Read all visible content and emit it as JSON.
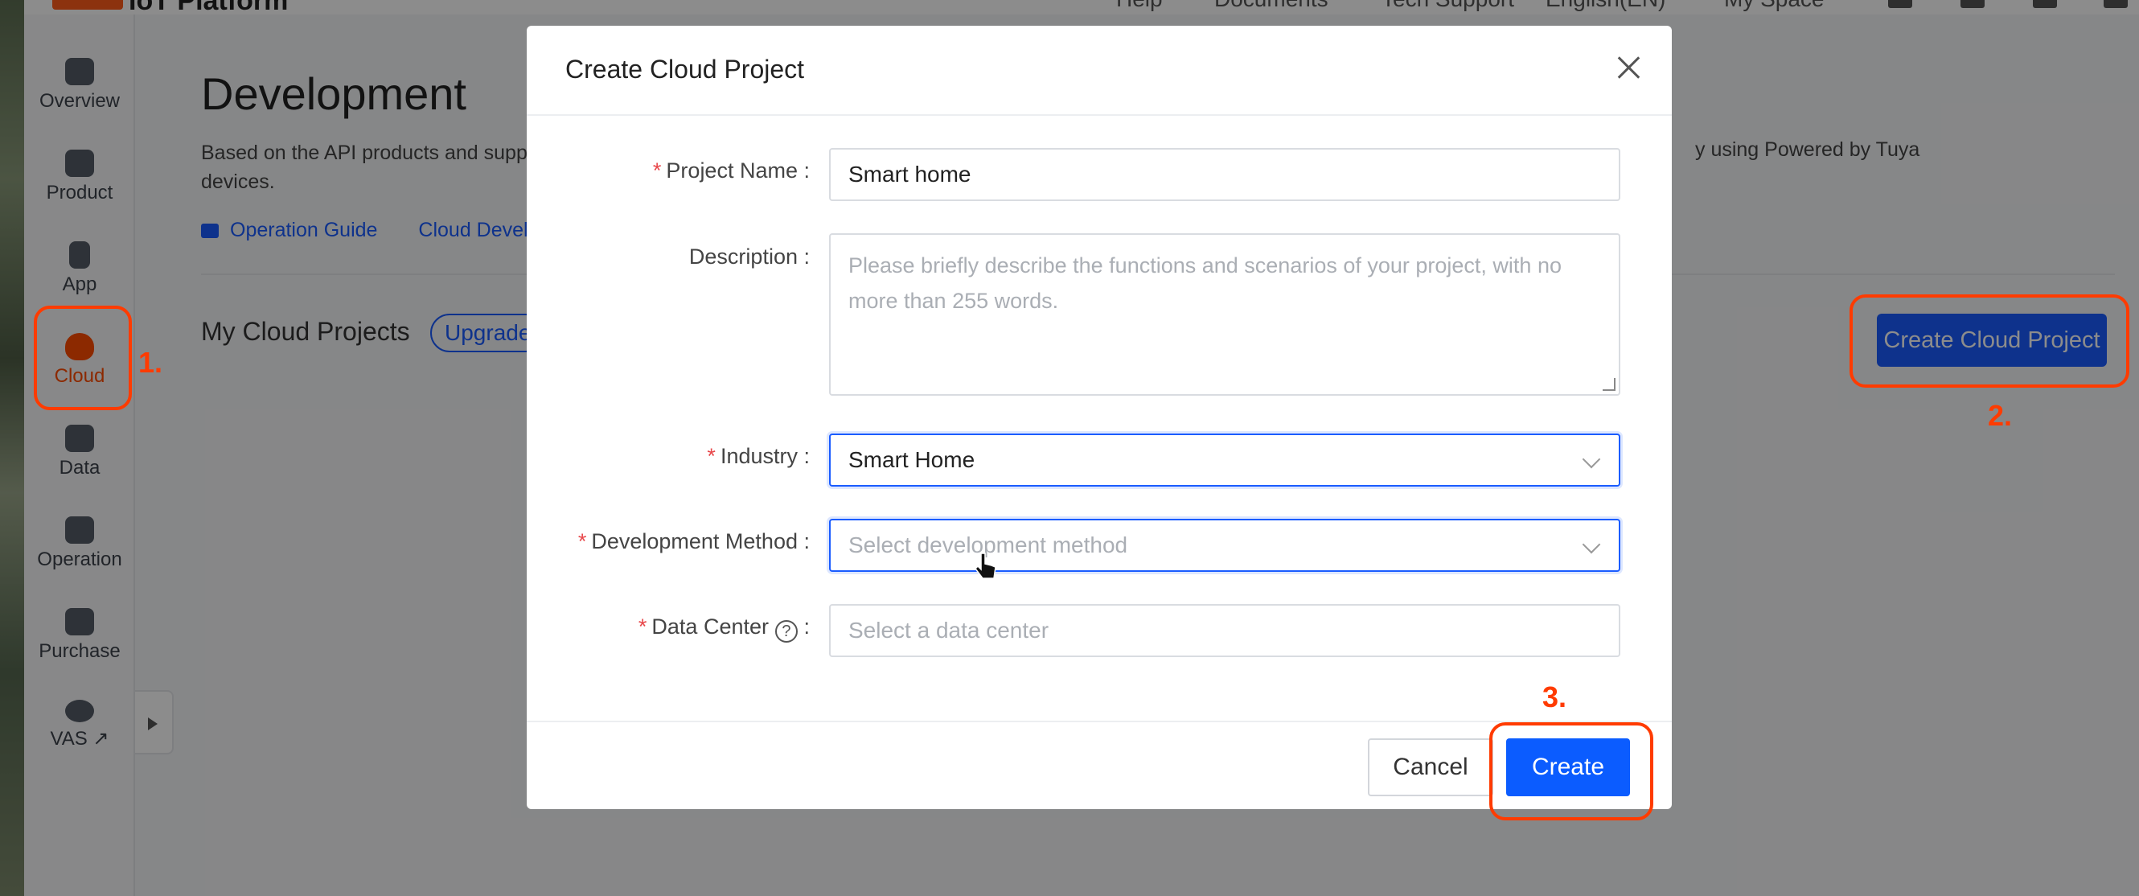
{
  "topbar": {
    "brand": "IoT Platform",
    "nav": [
      "Help",
      "Documents",
      "Tech Support",
      "English(EN)",
      "My Space"
    ]
  },
  "sidebar": {
    "items": [
      {
        "label": "Overview",
        "icon": "home-icon"
      },
      {
        "label": "Product",
        "icon": "terminal-icon"
      },
      {
        "label": "App",
        "icon": "phone-icon"
      },
      {
        "label": "Cloud",
        "icon": "cloud-icon",
        "active": true
      },
      {
        "label": "Data",
        "icon": "chart-icon"
      },
      {
        "label": "Operation",
        "icon": "bookmark-icon"
      },
      {
        "label": "Purchase",
        "icon": "box-icon"
      },
      {
        "label": "VAS ↗",
        "icon": "diamond-icon"
      }
    ]
  },
  "main": {
    "title": "Development",
    "description_start": "Based on the API products and suppo",
    "description_line2": "devices.",
    "description_tail": "y using Powered by Tuya",
    "links": [
      "Operation Guide",
      "Cloud Develo"
    ],
    "projects_title": "My Cloud Projects",
    "upgrade_badge": "Upgrade",
    "create_button": "Create Cloud Project"
  },
  "modal": {
    "title": "Create Cloud Project",
    "fields": {
      "project_name": {
        "label": "Project Name",
        "value": "Smart home",
        "required": true
      },
      "description": {
        "label": "Description",
        "placeholder": "Please briefly describe the functions and scenarios of your project, with no more than 255 words."
      },
      "industry": {
        "label": "Industry",
        "value": "Smart Home",
        "required": true
      },
      "development_method": {
        "label": "Development Method",
        "placeholder": "Select development method",
        "required": true
      },
      "data_center": {
        "label": "Data Center",
        "placeholder": "Select a data center",
        "required": true
      }
    },
    "cancel_label": "Cancel",
    "create_label": "Create"
  },
  "annotations": {
    "step1": "1.",
    "step2": "2.",
    "step3": "3.",
    "color": "#ff3b00"
  },
  "colors": {
    "primary": "#1a5cff",
    "accent": "#ff4b00",
    "required": "#e8484b"
  }
}
